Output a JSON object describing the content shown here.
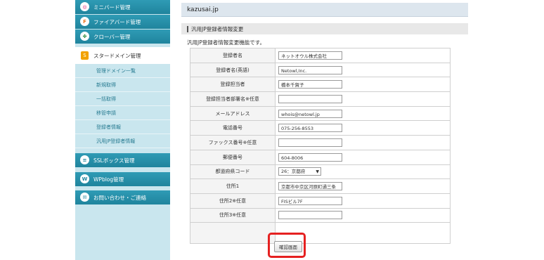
{
  "sidebar": {
    "items": [
      {
        "label": "ミニバード管理",
        "icon": "minibird-icon",
        "glyph": "◎"
      },
      {
        "label": "ファイアバード管理",
        "icon": "firebird-icon",
        "glyph": "F"
      },
      {
        "label": "クローバー管理",
        "icon": "clover-icon",
        "glyph": "✤"
      }
    ],
    "active": {
      "label": "スタードメイン管理",
      "icon": "star-domain-icon",
      "glyph": "S"
    },
    "sub_items": [
      "管理ドメイン一覧",
      "新規取得",
      "一括取得",
      "移管申請",
      "登録者情報",
      "汎用JP登録者情報"
    ],
    "bottom_items": [
      {
        "label": "SSLボックス管理",
        "icon": "ssl-icon",
        "glyph": "≡"
      },
      {
        "label": "WPblog管理",
        "icon": "wordpress-icon",
        "glyph": "W"
      },
      {
        "label": "お問い合わせ・ご連絡",
        "icon": "contact-icon",
        "glyph": "✉"
      }
    ]
  },
  "header": {
    "domain": "kazusai.jp"
  },
  "section": {
    "title": "汎用JP登録者情報変更",
    "description": "汎用JP登録者情報変更機能です。"
  },
  "form": {
    "rows": [
      {
        "label": "登録者名",
        "value": "ネットオウル株式会社",
        "type": "text"
      },
      {
        "label": "登録者名(英語)",
        "value": "Netowl,Inc.",
        "type": "text"
      },
      {
        "label": "登録担当者",
        "value": "橋本千賀子",
        "type": "text"
      },
      {
        "label": "登録担当者部署名※任意",
        "value": "",
        "type": "text"
      },
      {
        "label": "メールアドレス",
        "value": "whois@netowl.jp",
        "type": "text"
      },
      {
        "label": "電話番号",
        "value": "075-256-8553",
        "type": "text"
      },
      {
        "label": "ファックス番号※任意",
        "value": "",
        "type": "text"
      },
      {
        "label": "郵便番号",
        "value": "604-8006",
        "type": "text"
      },
      {
        "label": "都道府県コード",
        "value": "26：京都府",
        "type": "select"
      },
      {
        "label": "住所1",
        "value": "京都市中京区河原町通三条",
        "type": "text"
      },
      {
        "label": "住所2※任意",
        "value": "FISビル7F",
        "type": "text"
      },
      {
        "label": "住所3※任意",
        "value": "",
        "type": "text"
      }
    ],
    "submit_label": "確認画面"
  },
  "colors": {
    "sidebar_accent": "#2f9bb5",
    "sidebar_bg": "#c9e6ee",
    "highlight": "#e52121"
  }
}
